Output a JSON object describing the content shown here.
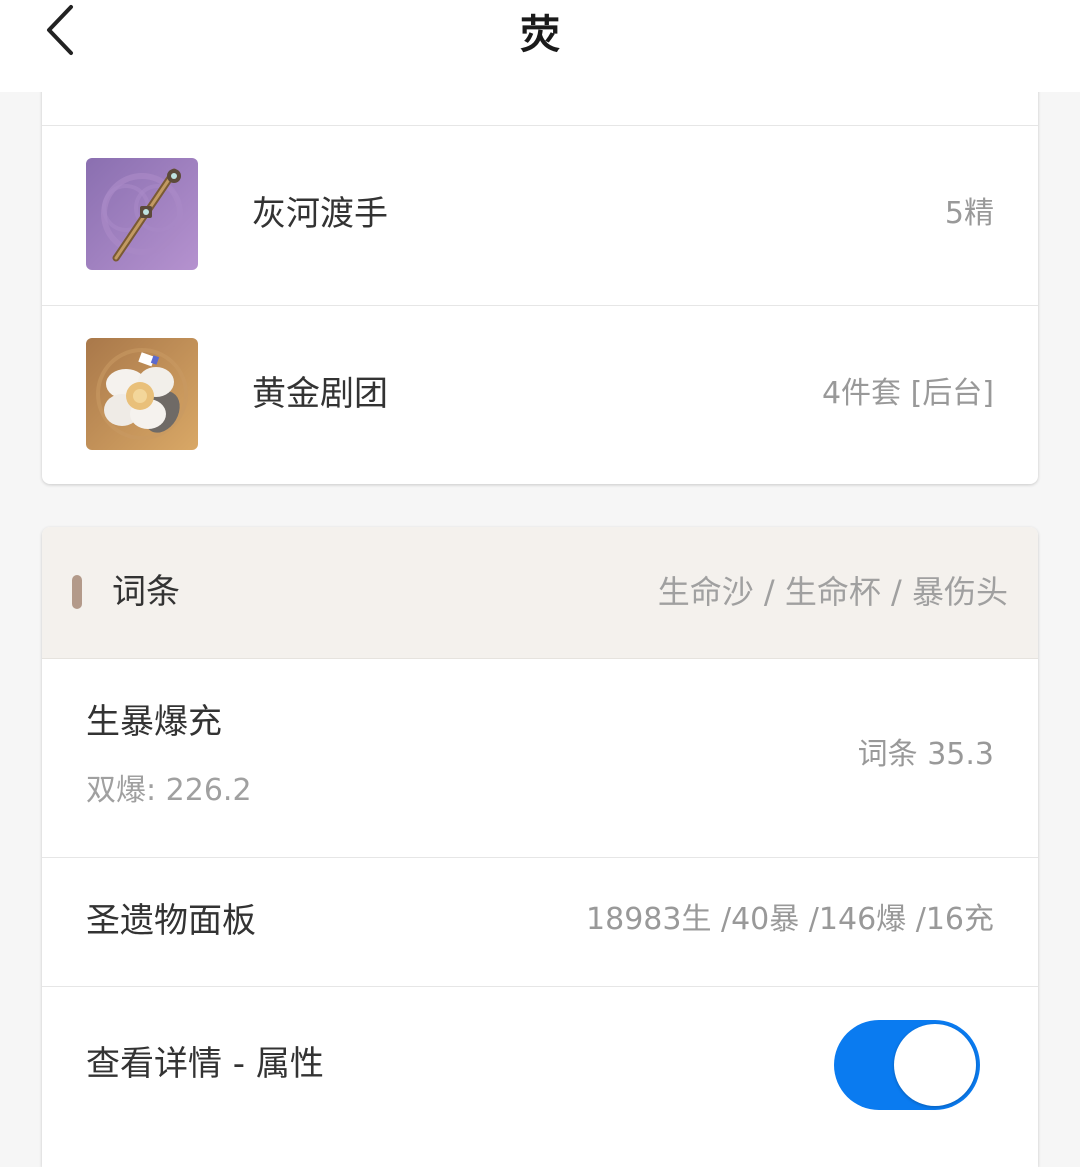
{
  "header": {
    "title": "荧",
    "back_icon": "chevron-left-icon"
  },
  "equipment": {
    "weapon": {
      "name": "灰河渡手",
      "value": "5精",
      "icon": "polearm-weapon-icon"
    },
    "artifact": {
      "name": "黄金剧团",
      "value": "4件套 [后台]",
      "icon": "flower-artifact-icon"
    }
  },
  "substats": {
    "title": "词条",
    "subtitle": "生命沙 / 生命杯 / 暴伤头",
    "build": {
      "label": "生暴爆充",
      "sublabel": "双爆: 226.2",
      "value": "词条 35.3"
    },
    "panel": {
      "label": "圣遗物面板",
      "value": "18983生 /40暴 /146爆 /16充"
    },
    "detail": {
      "label": "查看详情 - 属性",
      "toggle_on": true
    }
  },
  "colors": {
    "accent": "#0a7bf0",
    "section_bar": "#b39a8a",
    "section_bg": "#f4f1ed"
  }
}
